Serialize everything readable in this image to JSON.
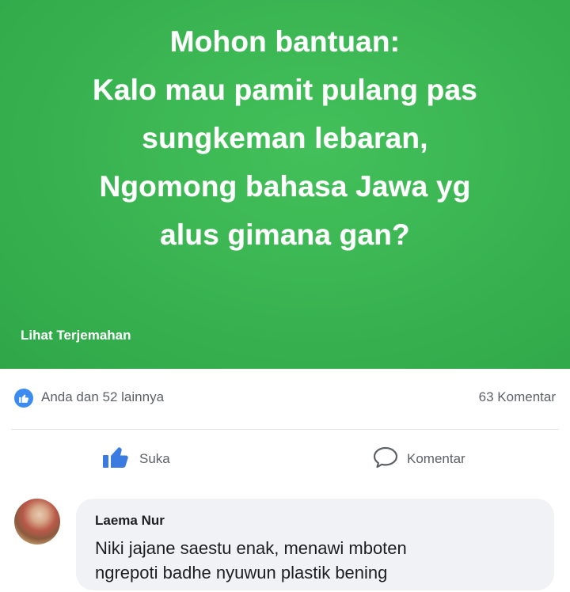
{
  "post": {
    "lines": [
      "Mohon bantuan:",
      "Kalo mau pamit pulang pas",
      "sungkeman lebaran,",
      "Ngomong bahasa Jawa yg",
      "alus gimana gan?"
    ],
    "translate_link": "Lihat Terjemahan",
    "background_color": "#3ab552"
  },
  "reactions": {
    "icon": "like-icon",
    "text": "Anda dan 52 lainnya",
    "comment_count": "63 Komentar",
    "accent_color": "#3b8bf0"
  },
  "actions": {
    "like_label": "Suka",
    "like_icon": "thumbs-up-icon",
    "comment_label": "Komentar",
    "comment_icon": "speech-bubble-icon"
  },
  "comment": {
    "author": "Laema Nur",
    "lines": [
      "Niki jajane saestu enak, menawi mboten",
      "ngrepoti badhe nyuwun plastik bening"
    ]
  }
}
